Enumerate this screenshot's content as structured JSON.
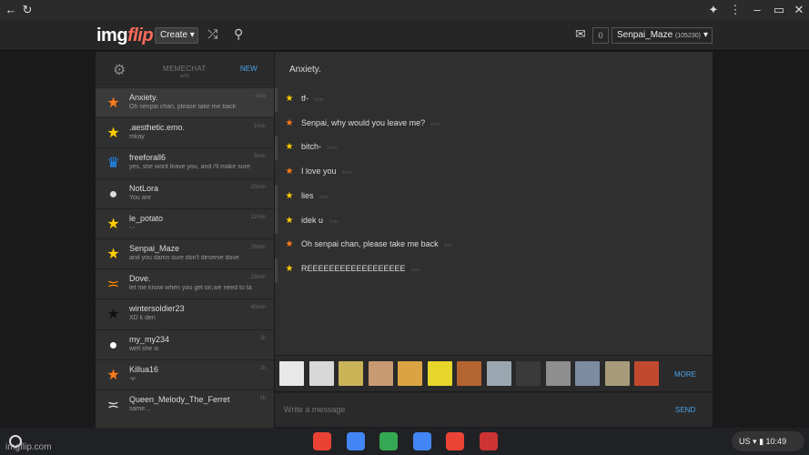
{
  "site": {
    "logo_main": "img",
    "logo_accent": "flip",
    "create_label": "Create ▾",
    "notif_count": "0",
    "username": "Senpai_Maze",
    "user_points": "(105230)"
  },
  "sidebar": {
    "title": "MEMECHAT",
    "subtitle": "arm",
    "new_label": "NEW",
    "convos": [
      {
        "name": "Anxiety.",
        "msg": "Oh senpai chan, please take me back",
        "time": "now",
        "icon": "star-icon",
        "color": "#ff7a1a"
      },
      {
        "name": ".aesthetic.emo.",
        "msg": "mkay",
        "time": "1min",
        "icon": "rainbow-star-icon",
        "color": "#ffcc00"
      },
      {
        "name": "freeforall6",
        "msg": "yes, she wont leave you, and i'll make sure",
        "time": "5min",
        "icon": "crown-icon",
        "color": "#1e90ff"
      },
      {
        "name": "NotLora",
        "msg": "You are",
        "time": "20min",
        "icon": "user-icon",
        "color": "#dddddd"
      },
      {
        "name": "le_potato",
        "msg": "-.-",
        "time": "22min",
        "icon": "rainbow-star-icon",
        "color": "#ffcc00"
      },
      {
        "name": "Senpai_Maze",
        "msg": "and you damn sure don't deserve dove",
        "time": "26min",
        "icon": "rainbow-star-icon",
        "color": "#ffcc00"
      },
      {
        "name": "Dove.",
        "msg": "let me know when you get on,we need to ta",
        "time": "29min",
        "icon": "dove-icon",
        "color": "#ff8800"
      },
      {
        "name": "wintersoldier23",
        "msg": "XD k den",
        "time": "40min",
        "icon": "black-star-icon",
        "color": "#111111"
      },
      {
        "name": "my_my234",
        "msg": "well she is",
        "time": "1h",
        "icon": "person-icon",
        "color": "#ffffff"
      },
      {
        "name": "Killua16",
        "msg": "-v-",
        "time": "1h",
        "icon": "star-icon",
        "color": "#ff7a1a"
      },
      {
        "name": "Queen_Melody_The_Ferret",
        "msg": "same...",
        "time": "1h",
        "icon": "dove-icon",
        "color": "#dddddd"
      }
    ]
  },
  "chat": {
    "title": "Anxiety.",
    "messages": [
      {
        "text": "tf-",
        "time": "5min",
        "icon": "rainbow-star-icon",
        "color": "#ffcc00"
      },
      {
        "text": "Senpai, why would you leave me?",
        "time": "4min",
        "icon": "star-icon",
        "color": "#ff7a1a"
      },
      {
        "text": "bitch-",
        "time": "3min",
        "icon": "rainbow-star-icon",
        "color": "#ffcc00"
      },
      {
        "text": "I love you",
        "time": "2min",
        "icon": "star-icon",
        "color": "#ff7a1a"
      },
      {
        "text": "lies",
        "time": "1min",
        "icon": "rainbow-star-icon",
        "color": "#ffcc00"
      },
      {
        "text": "idek u",
        "time": "1min",
        "icon": "rainbow-star-icon",
        "color": "#ffcc00"
      },
      {
        "text": "Oh senpai chan, please take me back",
        "time": "now",
        "icon": "star-icon",
        "color": "#ff7a1a"
      },
      {
        "text": "REEEEEEEEEEEEEEEEEE",
        "time": "now",
        "icon": "rainbow-star-icon",
        "color": "#ffcc00"
      }
    ],
    "more_label": "MORE",
    "input_placeholder": "Write a message",
    "send_label": "SEND"
  },
  "stickers": [
    {
      "name": "sticker-troll-face",
      "color": "#e8e8e8"
    },
    {
      "name": "sticker-rage-face",
      "color": "#d8d8d8"
    },
    {
      "name": "sticker-deal-with-it",
      "color": "#c9b458"
    },
    {
      "name": "sticker-laughing-girl",
      "color": "#c79a72"
    },
    {
      "name": "sticker-doge",
      "color": "#d9a441"
    },
    {
      "name": "sticker-spongebob",
      "color": "#e6d62a"
    },
    {
      "name": "sticker-person",
      "color": "#b5652f"
    },
    {
      "name": "sticker-baby",
      "color": "#9aa7b0"
    },
    {
      "name": "sticker-dark-face",
      "color": "#3a3a3a"
    },
    {
      "name": "sticker-photo-1",
      "color": "#8e8e8e"
    },
    {
      "name": "sticker-photo-2",
      "color": "#7b8ca0"
    },
    {
      "name": "sticker-photo-3",
      "color": "#a89b7a"
    },
    {
      "name": "sticker-photo-4",
      "color": "#c14a2e"
    }
  ],
  "taskbar": {
    "watermark": "imgflip.com",
    "region": "US",
    "time": "10:49",
    "apps": [
      {
        "name": "chrome-icon",
        "color": "#e94235"
      },
      {
        "name": "docs-icon",
        "color": "#4285f4"
      },
      {
        "name": "drive-icon",
        "color": "#34a853"
      },
      {
        "name": "files-icon",
        "color": "#4285f4"
      },
      {
        "name": "gmail-icon",
        "color": "#ea4335"
      },
      {
        "name": "imgflip-icon",
        "color": "#cc3333"
      }
    ]
  }
}
